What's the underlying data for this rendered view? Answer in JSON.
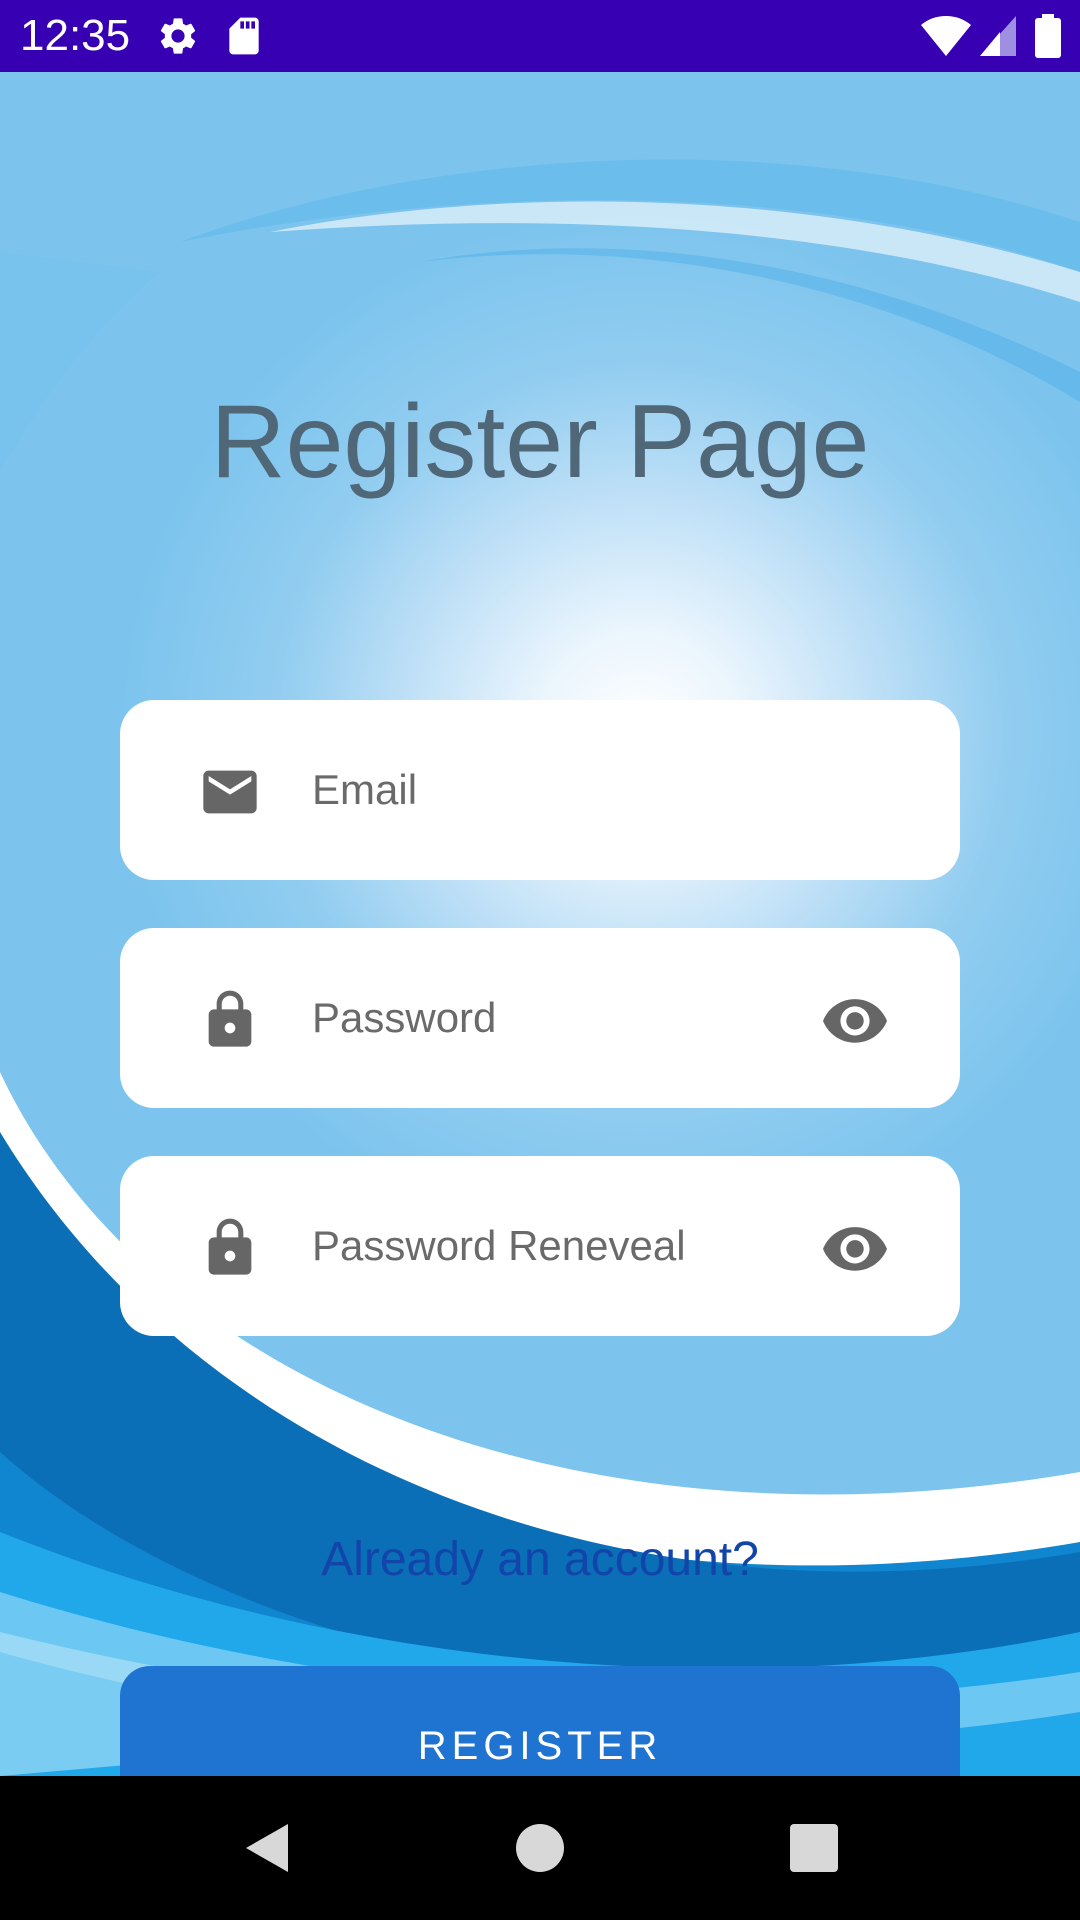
{
  "status_bar": {
    "time": "12:35",
    "left_icons": [
      "gear-icon",
      "sd-card-icon"
    ],
    "right_icons": [
      "wifi-icon",
      "cell-signal-icon",
      "battery-icon"
    ],
    "background": "#3700b3"
  },
  "page": {
    "title": "Register Page"
  },
  "form": {
    "email": {
      "placeholder": "Email",
      "icon": "mail-icon"
    },
    "password": {
      "placeholder": "Password",
      "icon": "lock-icon",
      "toggle_icon": "eye-icon"
    },
    "password_confirm": {
      "placeholder": "Password Reneveal",
      "icon": "lock-icon",
      "toggle_icon": "eye-icon"
    }
  },
  "links": {
    "login": "Already an account?"
  },
  "actions": {
    "register_label": "REGISTER"
  },
  "nav_bar": {
    "buttons": [
      "back-icon",
      "home-icon",
      "recents-icon"
    ]
  },
  "colors": {
    "accent": "#1e74d0",
    "link": "#1145a9",
    "title": "#4f6777"
  }
}
